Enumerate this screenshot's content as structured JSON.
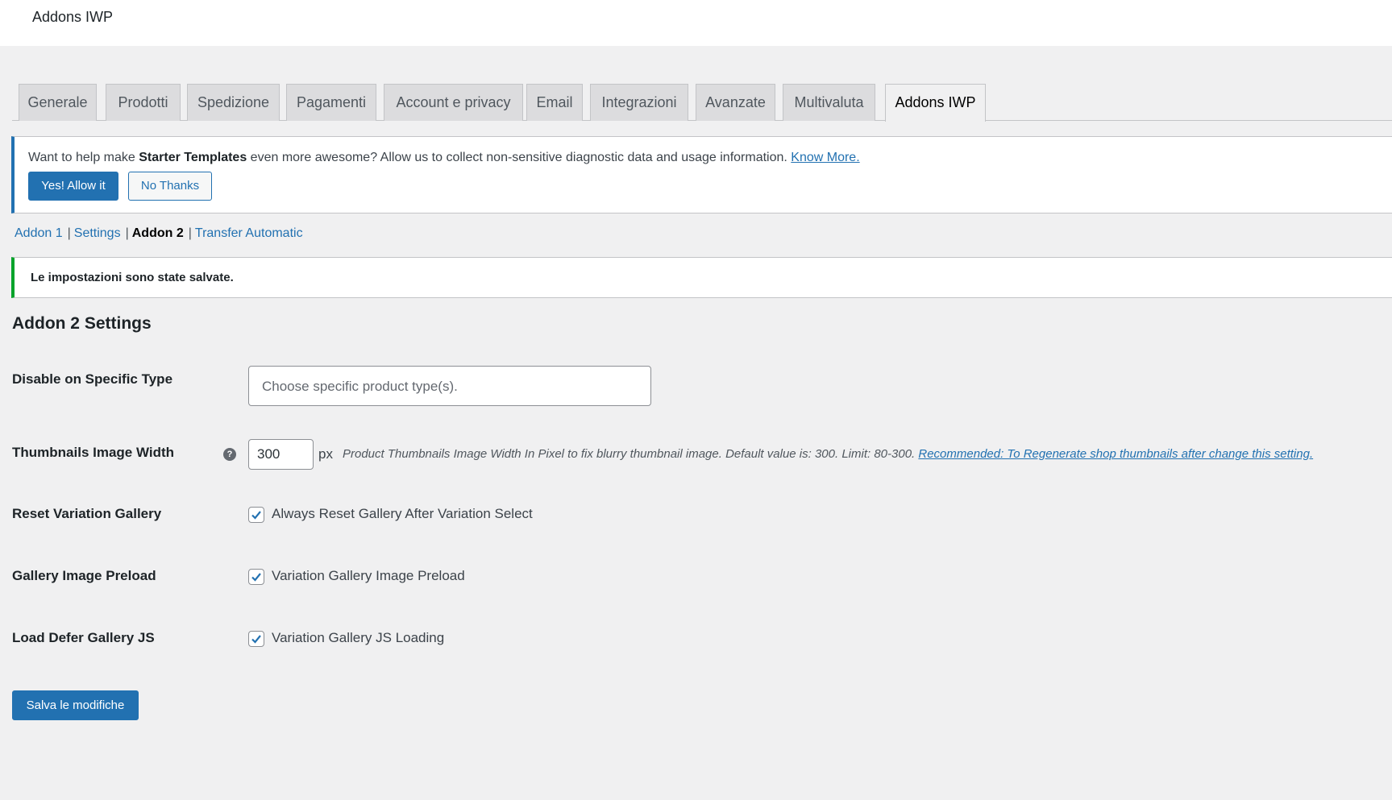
{
  "header": {
    "title": "Addons IWP"
  },
  "tabs": [
    {
      "label": "Generale"
    },
    {
      "label": "Prodotti"
    },
    {
      "label": "Spedizione"
    },
    {
      "label": "Pagamenti"
    },
    {
      "label": "Account e privacy"
    },
    {
      "label": "Email"
    },
    {
      "label": "Integrazioni"
    },
    {
      "label": "Avanzate"
    },
    {
      "label": "Multivaluta"
    },
    {
      "label": "Addons IWP",
      "active": true
    }
  ],
  "notice": {
    "text_before": "Want to help make ",
    "brand": "Starter Templates",
    "text_after": " even more awesome? Allow us to collect non-sensitive diagnostic data and usage information. ",
    "link": "Know More.",
    "allow_button": "Yes! Allow it",
    "deny_button": "No Thanks"
  },
  "subnav": {
    "items": [
      {
        "label": "Addon 1"
      },
      {
        "label": "Settings"
      },
      {
        "label": "Addon 2",
        "current": true
      },
      {
        "label": "Transfer Automatic"
      }
    ],
    "separator": "|"
  },
  "success_message": "Le impostazioni sono state salvate.",
  "settings": {
    "title": "Addon 2 Settings",
    "disable_type": {
      "label": "Disable on Specific Type",
      "placeholder": "Choose specific product type(s)."
    },
    "thumb_width": {
      "label": "Thumbnails Image Width",
      "help_icon": "?",
      "value": "300",
      "unit": "px",
      "description": "Product Thumbnails Image Width In Pixel to fix blurry thumbnail image. Default value is: 300. Limit: 80-300.",
      "link": "Recommended: To Regenerate shop thumbnails after change this setting."
    },
    "reset_gallery": {
      "label": "Reset Variation Gallery",
      "checkbox_label": "Always Reset Gallery After Variation Select",
      "checked": true
    },
    "gallery_preload": {
      "label": "Gallery Image Preload",
      "checkbox_label": "Variation Gallery Image Preload",
      "checked": true
    },
    "defer_js": {
      "label": "Load Defer Gallery JS",
      "checkbox_label": "Variation Gallery JS Loading",
      "checked": true
    }
  },
  "save_button": "Salva le modifiche",
  "colors": {
    "primary": "#2271b1",
    "success": "#00a32a",
    "background": "#f0f0f1"
  }
}
